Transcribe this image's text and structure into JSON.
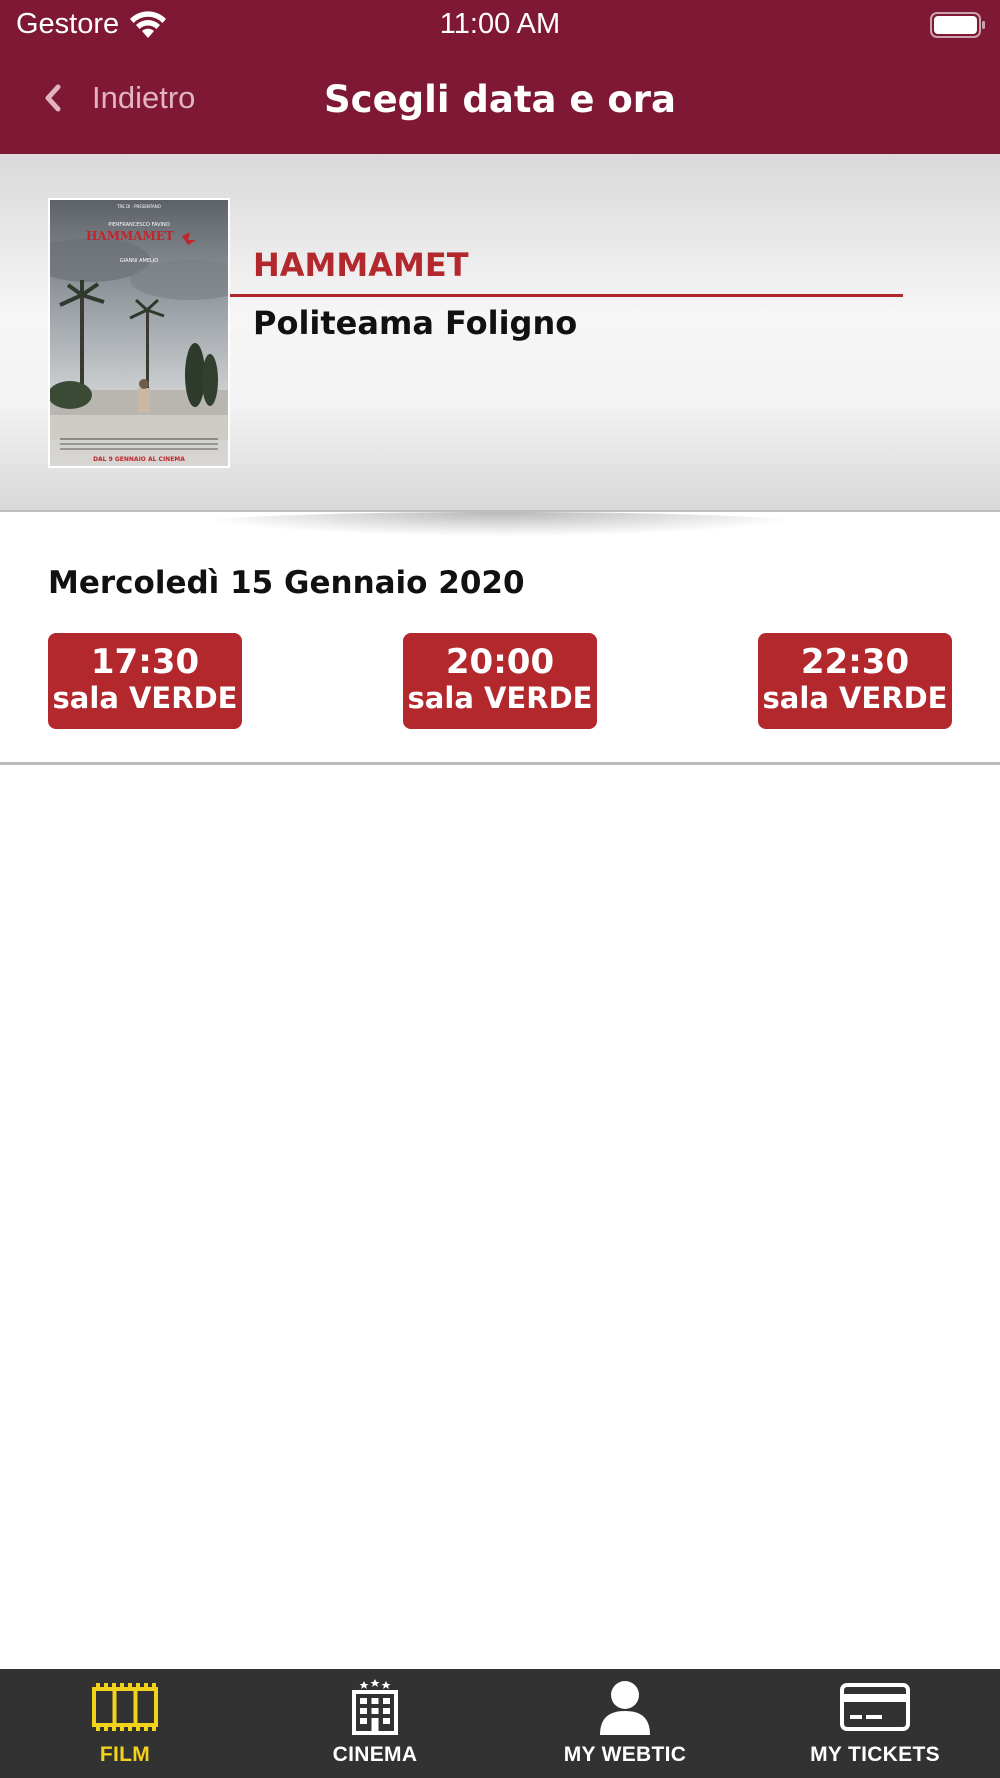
{
  "status_bar": {
    "carrier": "Gestore",
    "time": "11:00 AM"
  },
  "nav": {
    "back_label": "Indietro",
    "title": "Scegli data e ora"
  },
  "movie": {
    "title": "HAMMAMET",
    "cinema": "Politeama Foligno",
    "poster": {
      "title_text": "HAMMAMET",
      "actor_text": "PIERFRANCESCO FAVINO",
      "director_text": "GIANNI AMELIO",
      "release_text": "DAL 9 GENNAIO AL CINEMA"
    }
  },
  "schedule": {
    "date": "Mercoledì 15 Gennaio 2020",
    "showtimes": [
      {
        "time": "17:30",
        "room": "sala VERDE"
      },
      {
        "time": "20:00",
        "room": "sala VERDE"
      },
      {
        "time": "22:30",
        "room": "sala VERDE"
      }
    ]
  },
  "tabbar": {
    "tabs": [
      {
        "label": "FILM",
        "icon": "film-icon",
        "active": true
      },
      {
        "label": "CINEMA",
        "icon": "building-icon",
        "active": false
      },
      {
        "label": "MY WEBTIC",
        "icon": "user-icon",
        "active": false
      },
      {
        "label": "MY TICKETS",
        "icon": "card-icon",
        "active": false
      }
    ]
  },
  "colors": {
    "header": "#7e1834",
    "accent": "#b3282d",
    "tabbar": "#333233",
    "tab_active": "#f2d21b"
  }
}
